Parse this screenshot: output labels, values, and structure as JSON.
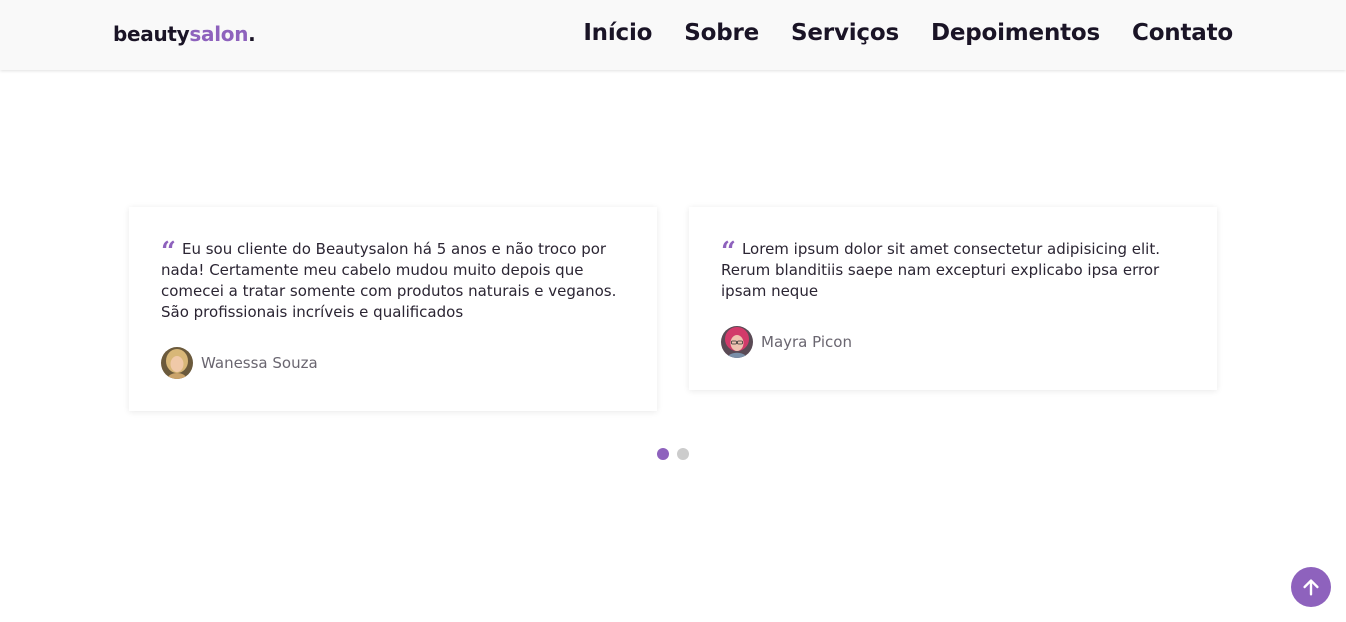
{
  "header": {
    "logo_main": "beauty",
    "logo_accent": "salon",
    "logo_dot": ".",
    "nav": [
      "Início",
      "Sobre",
      "Serviços",
      "Depoimentos",
      "Contato"
    ]
  },
  "testimonials": [
    {
      "text": "Eu sou cliente do Beautysalon há 5 anos e não troco por nada! Certamente meu cabelo mudou muito depois que comecei a tratar somente com produtos naturais e veganos. São profissionais incríveis e qualificados",
      "author": "Wanessa Souza"
    },
    {
      "text": "Lorem ipsum dolor sit amet consectetur adipisicing elit. Rerum blanditiis saepe nam excepturi explicabo ipsa error ipsam neque",
      "author": "Mayra Picon"
    }
  ],
  "quote_glyph": "“",
  "pagination": {
    "count": 2,
    "active": 0
  },
  "colors": {
    "accent": "#8e62bd",
    "text": "#1a1426",
    "muted": "#6a6670",
    "dot_inactive": "#cccccc"
  },
  "icons": {
    "back_to_top": "arrow-up-icon",
    "quote": "quote-icon"
  }
}
